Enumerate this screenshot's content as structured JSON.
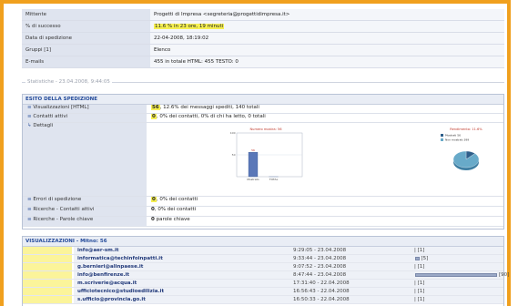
{
  "info": {
    "rows": [
      {
        "key": "Mittente",
        "value": "Progetti di Impresa <segreteria@progettidimpresa.it>"
      },
      {
        "key": "% di successo",
        "value_hl": "11.6 % in 23 ore, 19 minuti"
      },
      {
        "key": "Data di spedizione",
        "value": "22-04-2008, 18:19:02"
      },
      {
        "key": "Gruppi [1]",
        "value": "Elenco"
      },
      {
        "key": "E-mails",
        "value": "455 in totale   HTML: 455   TESTO: 0"
      }
    ]
  },
  "separator": "Statistiche - 23.04.2008, 9:44:05",
  "esito": {
    "title": "ESITO DELLA SPEDIZIONE",
    "rows": [
      {
        "key": "Visualizzazioni [HTML]",
        "num": "56",
        "rest": ", 12.6% dei messaggi spediti, 140 totali"
      },
      {
        "key": "Contatti attivi",
        "num": "0",
        "rest": ", 0% dei contatti, 0% di chi ha letto, 0 totali"
      },
      {
        "key": "Dettagli"
      },
      {
        "key": "Errori di spedizione",
        "num": "0",
        "rest": ", 0% dei contatti"
      },
      {
        "key": "Ricerche - Contatti attivi",
        "num": "0",
        "rest": ", 0% dei contatti"
      },
      {
        "key": "Ricerche - Parole chiave",
        "num": "0",
        "rest": " parole chiave"
      }
    ],
    "chart_label": "Numero mostra: 56",
    "pie_label": "Rendimento: 11.6%",
    "pie_legend": [
      "Mostrati 56",
      "Non mostrati 399"
    ]
  },
  "chart_data": [
    {
      "type": "bar",
      "title": "Numero mostra: 56",
      "categories": [
        "Mostrato",
        "TOTAL"
      ],
      "values": [
        56,
        0
      ],
      "data_labels": [
        "56",
        ""
      ],
      "ylim": [
        0,
        100
      ],
      "y_ticks": [
        "100",
        "50",
        ""
      ],
      "grid": true,
      "bar_color": "#5b78b8"
    },
    {
      "type": "pie",
      "title": "Rendimento: 11.6%",
      "categories": [
        "Mostrati 56",
        "Non mostrati 399"
      ],
      "values": [
        56,
        399
      ],
      "legend_position": "top-left",
      "colors": [
        "#2f5f8a",
        "#68aac9"
      ]
    }
  ],
  "visualizza": {
    "title": "VISUALIZZAZIONI - Mitno: 56",
    "rows": [
      {
        "email": "info@aer-sm.it",
        "date": "9:29:05 - 23.04.2008",
        "clicks": "[1]",
        "bar": 0
      },
      {
        "email": "informatica@techinfoinpatti.it",
        "date": "9:33:44 - 23.04.2008",
        "clicks": "[5]",
        "bar": 0.05
      },
      {
        "email": "g.bernieri@alinpaese.it",
        "date": "9:07:52 - 23.04.2008",
        "clicks": "[1]",
        "bar": 0
      },
      {
        "email": "info@benfirenze.it",
        "date": "8:47:44 - 23.04.2008",
        "clicks": "[90]",
        "bar": 1
      },
      {
        "email": "m.scriverie@acqua.it",
        "date": "17:31:40 - 22.04.2008",
        "clicks": "[1]",
        "bar": 0
      },
      {
        "email": "ufficiotecnico@studioedilizia.it",
        "date": "16:56:43 - 22.04.2008",
        "clicks": "[1]",
        "bar": 0
      },
      {
        "email": "s.ufficio@provincia.go.it",
        "date": "16:50:33 - 22.04.2008",
        "clicks": "[1]",
        "bar": 0
      }
    ]
  }
}
